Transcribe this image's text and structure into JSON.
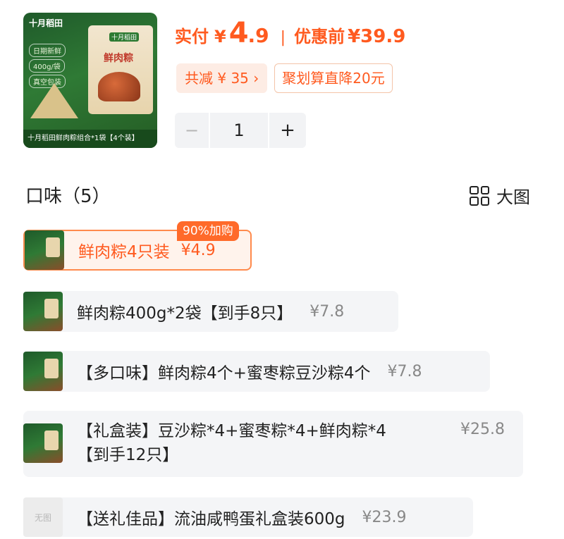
{
  "product": {
    "thumb": {
      "brand": "十月稻田",
      "features": [
        "日期新鲜",
        "400g/袋",
        "真空包装"
      ],
      "bag_brand": "十月稻田",
      "bag_title": "鲜肉粽",
      "caption": "十月稻田鲜肉粽组合*1袋【4个装】"
    },
    "paid_label": "实付",
    "currency": "¥",
    "price_int": "4",
    "price_dec": ".9",
    "orig_label": "优惠前",
    "orig_price": "¥39.9",
    "discount_tag": "共减 ¥ 35 ›",
    "promo_tag": "聚划算直降20元",
    "quantity": "1",
    "minus": "−",
    "plus": "+"
  },
  "section": {
    "title": "口味（5）",
    "view_label": "大图",
    "view_icon": "grid-icon"
  },
  "options": [
    {
      "label": "鲜肉粽4只装",
      "price": "¥4.9",
      "selected": true,
      "badge": "90%加购"
    },
    {
      "label": "鲜肉粽400g*2袋【到手8只】",
      "price": "¥7.8"
    },
    {
      "label": "【多口味】鲜肉粽4个+蜜枣粽豆沙粽4个",
      "price": "¥7.8"
    },
    {
      "label_line1": "【礼盒装】豆沙粽*4+蜜枣粽*4+鲜肉粽*4",
      "label_line2": "【到手12只】",
      "price": "¥25.8"
    },
    {
      "noimg": "无图",
      "label": "【送礼佳品】流油咸鸭蛋礼盒装600g",
      "price": "¥23.9"
    }
  ],
  "colors": {
    "accent": "#ff5a1f",
    "selected_bg": "#fff3ec",
    "option_bg": "#f4f5f7"
  }
}
